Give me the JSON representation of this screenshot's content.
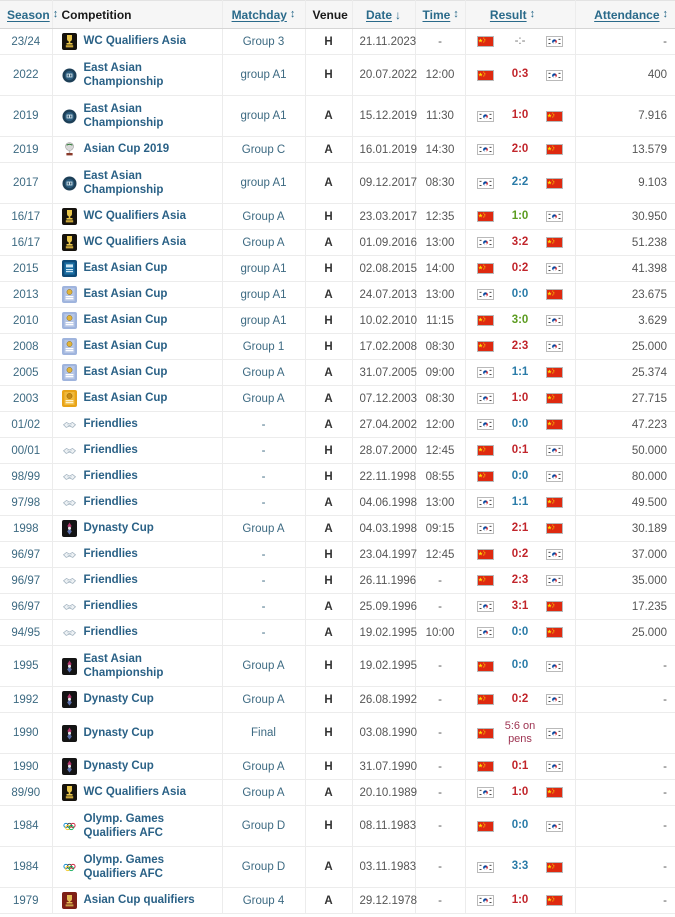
{
  "table": {
    "headers": [
      {
        "key": "season",
        "label": "Season",
        "link": true,
        "sort": "both"
      },
      {
        "key": "competition",
        "label": "Competition",
        "link": false,
        "sort": "none"
      },
      {
        "key": "matchday",
        "label": "Matchday",
        "link": true,
        "sort": "both"
      },
      {
        "key": "venue",
        "label": "Venue",
        "link": false,
        "sort": "none"
      },
      {
        "key": "date",
        "label": "Date",
        "link": true,
        "sort": "desc"
      },
      {
        "key": "time",
        "label": "Time",
        "link": true,
        "sort": "both"
      },
      {
        "key": "result",
        "label": "Result",
        "link": true,
        "sort": "both"
      },
      {
        "key": "attendance",
        "label": "Attendance",
        "link": true,
        "sort": "both"
      }
    ],
    "sort_icons": {
      "both": "↕",
      "desc": "↓"
    },
    "colors": {
      "win": "#5c9c20",
      "loss": "#c1252b",
      "draw": "#2a7ba8",
      "pens": "#9e3452",
      "link": "#2a6a8a",
      "header_bg": "#f6f6f6"
    },
    "rows": [
      {
        "season": "23/24",
        "competition": "WC Qualifiers Asia",
        "icon": "wc-qualifiers-trophy-icon",
        "matchday": "Group 3",
        "venue": "H",
        "date": "21.11.2023",
        "time": "-",
        "home_flag": "china",
        "away_flag": "south-korea",
        "score": "-:-",
        "outcome": "none",
        "attendance": "-",
        "lines": 1
      },
      {
        "season": "2022",
        "competition": "East Asian Championship",
        "icon": "east-asian-championship-icon",
        "matchday": "group A1",
        "venue": "H",
        "date": "20.07.2022",
        "time": "12:00",
        "home_flag": "china",
        "away_flag": "south-korea",
        "score": "0:3",
        "outcome": "loss",
        "attendance": "400",
        "lines": 2
      },
      {
        "season": "2019",
        "competition": "East Asian Championship",
        "icon": "east-asian-championship-icon",
        "matchday": "group A1",
        "venue": "A",
        "date": "15.12.2019",
        "time": "11:30",
        "home_flag": "south-korea",
        "away_flag": "china",
        "score": "1:0",
        "outcome": "loss",
        "attendance": "7.916",
        "lines": 2
      },
      {
        "season": "2019",
        "competition": "Asian Cup 2019",
        "icon": "asian-cup-trophy-icon",
        "matchday": "Group C",
        "venue": "A",
        "date": "16.01.2019",
        "time": "14:30",
        "home_flag": "south-korea",
        "away_flag": "china",
        "score": "2:0",
        "outcome": "loss",
        "attendance": "13.579",
        "lines": 1
      },
      {
        "season": "2017",
        "competition": "East Asian Championship",
        "icon": "east-asian-championship-icon",
        "matchday": "group A1",
        "venue": "A",
        "date": "09.12.2017",
        "time": "08:30",
        "home_flag": "south-korea",
        "away_flag": "china",
        "score": "2:2",
        "outcome": "draw",
        "attendance": "9.103",
        "lines": 2
      },
      {
        "season": "16/17",
        "competition": "WC Qualifiers Asia",
        "icon": "wc-qualifiers-trophy-icon",
        "matchday": "Group A",
        "venue": "H",
        "date": "23.03.2017",
        "time": "12:35",
        "home_flag": "china",
        "away_flag": "south-korea",
        "score": "1:0",
        "outcome": "win",
        "attendance": "30.950",
        "lines": 1
      },
      {
        "season": "16/17",
        "competition": "WC Qualifiers Asia",
        "icon": "wc-qualifiers-trophy-icon",
        "matchday": "Group A",
        "venue": "A",
        "date": "01.09.2016",
        "time": "13:00",
        "home_flag": "south-korea",
        "away_flag": "china",
        "score": "3:2",
        "outcome": "loss",
        "attendance": "51.238",
        "lines": 1
      },
      {
        "season": "2015",
        "competition": "East Asian Cup",
        "icon": "east-asian-cup-dark-icon",
        "matchday": "group A1",
        "venue": "H",
        "date": "02.08.2015",
        "time": "14:00",
        "home_flag": "china",
        "away_flag": "south-korea",
        "score": "0:2",
        "outcome": "loss",
        "attendance": "41.398",
        "lines": 1
      },
      {
        "season": "2013",
        "competition": "East Asian Cup",
        "icon": "east-asian-cup-light-icon",
        "matchday": "group A1",
        "venue": "A",
        "date": "24.07.2013",
        "time": "13:00",
        "home_flag": "south-korea",
        "away_flag": "china",
        "score": "0:0",
        "outcome": "draw",
        "attendance": "23.675",
        "lines": 1
      },
      {
        "season": "2010",
        "competition": "East Asian Cup",
        "icon": "east-asian-cup-light-icon",
        "matchday": "group A1",
        "venue": "H",
        "date": "10.02.2010",
        "time": "11:15",
        "home_flag": "china",
        "away_flag": "south-korea",
        "score": "3:0",
        "outcome": "win",
        "attendance": "3.629",
        "lines": 1
      },
      {
        "season": "2008",
        "competition": "East Asian Cup",
        "icon": "east-asian-cup-light-icon",
        "matchday": "Group 1",
        "venue": "H",
        "date": "17.02.2008",
        "time": "08:30",
        "home_flag": "china",
        "away_flag": "south-korea",
        "score": "2:3",
        "outcome": "loss",
        "attendance": "25.000",
        "lines": 1
      },
      {
        "season": "2005",
        "competition": "East Asian Cup",
        "icon": "east-asian-cup-light-icon",
        "matchday": "Group A",
        "venue": "A",
        "date": "31.07.2005",
        "time": "09:00",
        "home_flag": "south-korea",
        "away_flag": "china",
        "score": "1:1",
        "outcome": "draw",
        "attendance": "25.374",
        "lines": 1
      },
      {
        "season": "2003",
        "competition": "East Asian Cup",
        "icon": "east-asian-cup-gold-icon",
        "matchday": "Group A",
        "venue": "A",
        "date": "07.12.2003",
        "time": "08:30",
        "home_flag": "south-korea",
        "away_flag": "china",
        "score": "1:0",
        "outcome": "loss",
        "attendance": "27.715",
        "lines": 1
      },
      {
        "season": "01/02",
        "competition": "Friendlies",
        "icon": "handshake-icon",
        "matchday": "-",
        "venue": "A",
        "date": "27.04.2002",
        "time": "12:00",
        "home_flag": "south-korea",
        "away_flag": "china",
        "score": "0:0",
        "outcome": "draw",
        "attendance": "47.223",
        "lines": 1
      },
      {
        "season": "00/01",
        "competition": "Friendlies",
        "icon": "handshake-icon",
        "matchday": "-",
        "venue": "H",
        "date": "28.07.2000",
        "time": "12:45",
        "home_flag": "china",
        "away_flag": "south-korea",
        "score": "0:1",
        "outcome": "loss",
        "attendance": "50.000",
        "lines": 1
      },
      {
        "season": "98/99",
        "competition": "Friendlies",
        "icon": "handshake-icon",
        "matchday": "-",
        "venue": "H",
        "date": "22.11.1998",
        "time": "08:55",
        "home_flag": "china",
        "away_flag": "south-korea",
        "score": "0:0",
        "outcome": "draw",
        "attendance": "80.000",
        "lines": 1
      },
      {
        "season": "97/98",
        "competition": "Friendlies",
        "icon": "handshake-icon",
        "matchday": "-",
        "venue": "A",
        "date": "04.06.1998",
        "time": "13:00",
        "home_flag": "south-korea",
        "away_flag": "china",
        "score": "1:1",
        "outcome": "draw",
        "attendance": "49.500",
        "lines": 1
      },
      {
        "season": "1998",
        "competition": "Dynasty Cup",
        "icon": "dynasty-cup-icon",
        "matchday": "Group A",
        "venue": "A",
        "date": "04.03.1998",
        "time": "09:15",
        "home_flag": "south-korea",
        "away_flag": "china",
        "score": "2:1",
        "outcome": "loss",
        "attendance": "30.189",
        "lines": 1
      },
      {
        "season": "96/97",
        "competition": "Friendlies",
        "icon": "handshake-icon",
        "matchday": "-",
        "venue": "H",
        "date": "23.04.1997",
        "time": "12:45",
        "home_flag": "china",
        "away_flag": "south-korea",
        "score": "0:2",
        "outcome": "loss",
        "attendance": "37.000",
        "lines": 1
      },
      {
        "season": "96/97",
        "competition": "Friendlies",
        "icon": "handshake-icon",
        "matchday": "-",
        "venue": "H",
        "date": "26.11.1996",
        "time": "-",
        "home_flag": "china",
        "away_flag": "south-korea",
        "score": "2:3",
        "outcome": "loss",
        "attendance": "35.000",
        "lines": 1
      },
      {
        "season": "96/97",
        "competition": "Friendlies",
        "icon": "handshake-icon",
        "matchday": "-",
        "venue": "A",
        "date": "25.09.1996",
        "time": "-",
        "home_flag": "south-korea",
        "away_flag": "china",
        "score": "3:1",
        "outcome": "loss",
        "attendance": "17.235",
        "lines": 1
      },
      {
        "season": "94/95",
        "competition": "Friendlies",
        "icon": "handshake-icon",
        "matchday": "-",
        "venue": "A",
        "date": "19.02.1995",
        "time": "10:00",
        "home_flag": "south-korea",
        "away_flag": "china",
        "score": "0:0",
        "outcome": "draw",
        "attendance": "25.000",
        "lines": 1
      },
      {
        "season": "1995",
        "competition": "East Asian Championship",
        "icon": "dynasty-cup-icon",
        "matchday": "Group A",
        "venue": "H",
        "date": "19.02.1995",
        "time": "-",
        "home_flag": "china",
        "away_flag": "south-korea",
        "score": "0:0",
        "outcome": "draw",
        "attendance": "-",
        "lines": 2
      },
      {
        "season": "1992",
        "competition": "Dynasty Cup",
        "icon": "dynasty-cup-icon",
        "matchday": "Group A",
        "venue": "H",
        "date": "26.08.1992",
        "time": "-",
        "home_flag": "china",
        "away_flag": "south-korea",
        "score": "0:2",
        "outcome": "loss",
        "attendance": "-",
        "lines": 1
      },
      {
        "season": "1990",
        "competition": "Dynasty Cup",
        "icon": "dynasty-cup-icon",
        "matchday": "Final",
        "venue": "H",
        "date": "03.08.1990",
        "time": "-",
        "home_flag": "china",
        "away_flag": "south-korea",
        "score": "5:6 on pens",
        "outcome": "pens",
        "attendance": "",
        "lines": 2
      },
      {
        "season": "1990",
        "competition": "Dynasty Cup",
        "icon": "dynasty-cup-icon",
        "matchday": "Group A",
        "venue": "H",
        "date": "31.07.1990",
        "time": "-",
        "home_flag": "china",
        "away_flag": "south-korea",
        "score": "0:1",
        "outcome": "loss",
        "attendance": "-",
        "lines": 1
      },
      {
        "season": "89/90",
        "competition": "WC Qualifiers Asia",
        "icon": "wc-qualifiers-trophy-icon",
        "matchday": "Group A",
        "venue": "A",
        "date": "20.10.1989",
        "time": "-",
        "home_flag": "south-korea",
        "away_flag": "china",
        "score": "1:0",
        "outcome": "loss",
        "attendance": "-",
        "lines": 1
      },
      {
        "season": "1984",
        "competition": "Olymp. Games Qualifiers AFC",
        "icon": "olympic-rings-icon",
        "matchday": "Group D",
        "venue": "H",
        "date": "08.11.1983",
        "time": "-",
        "home_flag": "china",
        "away_flag": "south-korea",
        "score": "0:0",
        "outcome": "draw",
        "attendance": "-",
        "lines": 2
      },
      {
        "season": "1984",
        "competition": "Olymp. Games Qualifiers AFC",
        "icon": "olympic-rings-icon",
        "matchday": "Group D",
        "venue": "A",
        "date": "03.11.1983",
        "time": "-",
        "home_flag": "south-korea",
        "away_flag": "china",
        "score": "3:3",
        "outcome": "draw",
        "attendance": "-",
        "lines": 2
      },
      {
        "season": "1979",
        "competition": "Asian Cup qualifiers",
        "icon": "asian-cup-qualifiers-icon",
        "matchday": "Group 4",
        "venue": "A",
        "date": "29.12.1978",
        "time": "-",
        "home_flag": "south-korea",
        "away_flag": "china",
        "score": "1:0",
        "outcome": "loss",
        "attendance": "-",
        "lines": 1
      }
    ]
  }
}
